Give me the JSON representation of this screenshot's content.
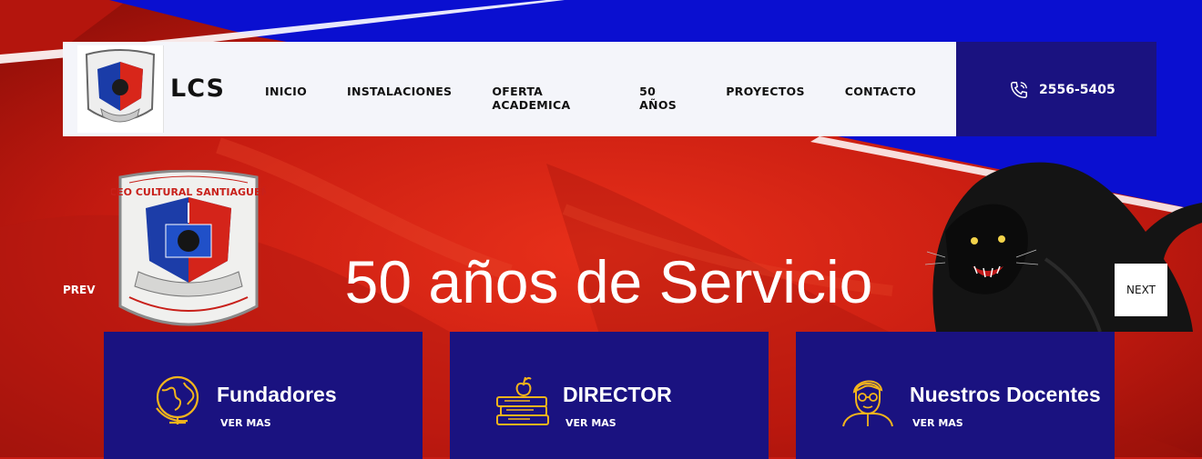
{
  "brand": {
    "name": "LCS"
  },
  "nav": {
    "items": [
      "INICIO",
      "INSTALACIONES",
      "OFERTA ACADEMICA",
      "50 AÑOS",
      "PROYECTOS",
      "CONTACTO"
    ]
  },
  "contact": {
    "phone": "2556-5405",
    "icon": "phone-icon"
  },
  "hero": {
    "headline": "50 años de Servicio",
    "prev_label": "PREV",
    "next_label": "NEXT",
    "emblem_text": "LICEO CULTURAL SANTIAGUEÑO"
  },
  "cards": [
    {
      "title": "Fundadores",
      "more": "VER MAS",
      "icon": "globe-icon"
    },
    {
      "title": "DIRECTOR",
      "more": "VER MAS",
      "icon": "books-apple-icon"
    },
    {
      "title": "Nuestros Docentes",
      "more": "VER MAS",
      "icon": "teacher-icon"
    }
  ],
  "colors": {
    "navy": "#1a1280",
    "red": "#c81b12",
    "blue": "#0a0fd0",
    "gold": "#f2b41c"
  }
}
